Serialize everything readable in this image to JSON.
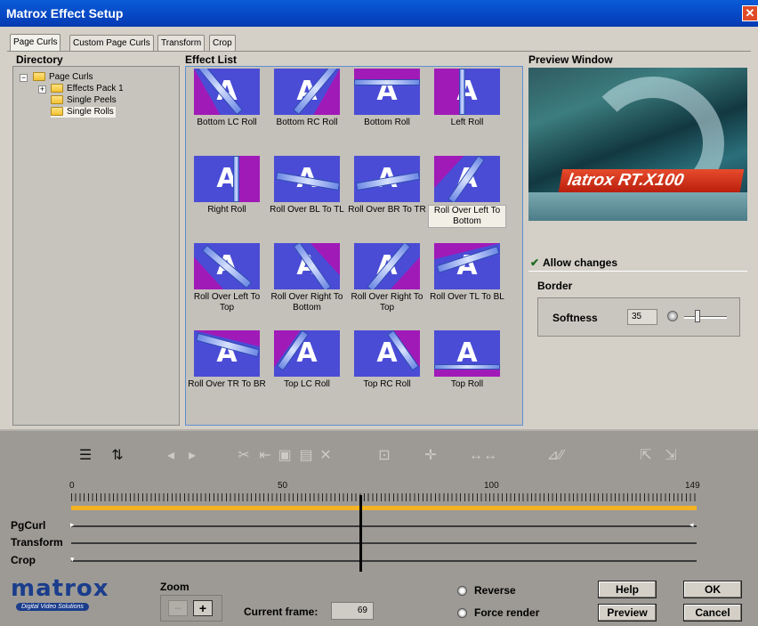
{
  "window": {
    "title": "Matrox Effect Setup",
    "close_glyph": "✕"
  },
  "tabs": [
    {
      "label": "Page Curls",
      "active": true
    },
    {
      "label": "Custom Page Curls",
      "active": false
    },
    {
      "label": "Transform",
      "active": false
    },
    {
      "label": "Crop",
      "active": false
    }
  ],
  "directory": {
    "title": "Directory",
    "items": [
      {
        "label": "Page Curls",
        "expander": "−"
      },
      {
        "label": "Effects Pack 1",
        "expander": "+"
      },
      {
        "label": "Single Peels",
        "expander": ""
      },
      {
        "label": "Single Rolls",
        "expander": "",
        "selected": true
      }
    ]
  },
  "effect_list": {
    "title": "Effect List",
    "letter": "A",
    "items": [
      {
        "label": "Bottom LC Roll"
      },
      {
        "label": "Bottom RC Roll"
      },
      {
        "label": "Bottom Roll"
      },
      {
        "label": "Left Roll"
      },
      {
        "label": "Right Roll"
      },
      {
        "label": "Roll Over BL To TL"
      },
      {
        "label": "Roll Over BR To TR"
      },
      {
        "label": "Roll Over Left To Bottom",
        "selected": true
      },
      {
        "label": "Roll Over Left To Top"
      },
      {
        "label": "Roll Over Right To Bottom"
      },
      {
        "label": "Roll Over Right To Top"
      },
      {
        "label": "Roll Over TL To BL"
      },
      {
        "label": "Roll Over TR To BR"
      },
      {
        "label": "Top LC Roll"
      },
      {
        "label": "Top RC Roll"
      },
      {
        "label": "Top Roll"
      }
    ]
  },
  "preview": {
    "title": "Preview Window",
    "brand_text": "latrox RT.X100",
    "allow_changes_label": "Allow changes",
    "allow_changes_checked": true
  },
  "border": {
    "title": "Border",
    "softness_label": "Softness",
    "softness_value": "35"
  },
  "timeline": {
    "ruler_labels": [
      "0",
      "50",
      "100",
      "149"
    ],
    "tracks": [
      "PgCurl",
      "Transform",
      "Crop"
    ],
    "playhead_frame": 69,
    "toolbar_icons": [
      "track-list-icon",
      "keyframe-toggle-icon",
      "prev-key-icon",
      "next-key-icon",
      "cut-icon",
      "select-icon",
      "copy-icon",
      "paste-icon",
      "delete-icon",
      "fit-icon",
      "center-icon",
      "ease-icon",
      "interp-icon",
      "linear-icon",
      "bezier-icon",
      "reverse-icon",
      "forward-icon"
    ]
  },
  "footer": {
    "logo_text": "matrox",
    "logo_sub": "Digital Video Solutions",
    "zoom_label": "Zoom",
    "zoom_minus": "−",
    "zoom_plus": "+",
    "current_frame_label": "Current frame:",
    "current_frame_value": "69",
    "reverse_label": "Reverse",
    "force_render_label": "Force render",
    "help_label": "Help",
    "ok_label": "OK",
    "preview_label": "Preview",
    "cancel_label": "Cancel"
  }
}
